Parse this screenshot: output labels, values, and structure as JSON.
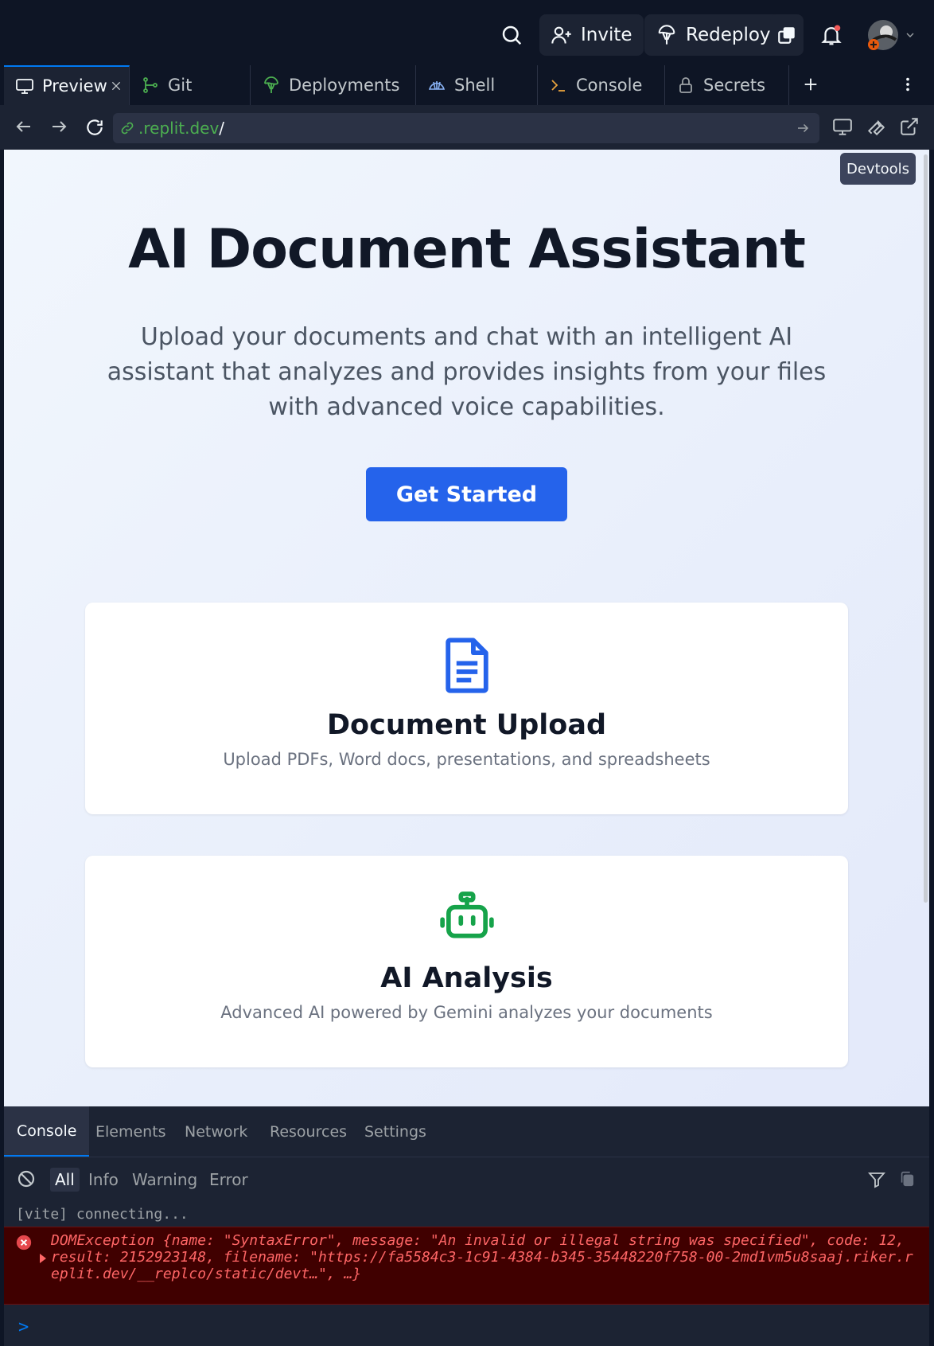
{
  "topbar": {
    "invite_label": "Invite",
    "redeploy_label": "Redeploy",
    "accent_color": "#0079f2",
    "notification_dot_color": "#f25a5a"
  },
  "tabs": [
    {
      "label": "Preview",
      "icon": "monitor-icon",
      "active": true
    },
    {
      "label": "Git",
      "icon": "git-branch-icon"
    },
    {
      "label": "Deployments",
      "icon": "deploy-icon"
    },
    {
      "label": "Shell",
      "icon": "shell-icon"
    },
    {
      "label": "Console",
      "icon": "terminal-icon"
    },
    {
      "label": "Secrets",
      "icon": "lock-icon"
    }
  ],
  "urlbar": {
    "url_domain": ".replit.dev",
    "url_path": "/"
  },
  "tooltip": {
    "label": "Devtools"
  },
  "page": {
    "title": "AI Document Assistant",
    "subtitle": "Upload your documents and chat with an intelligent AI assistant that analyzes and provides insights from your files with advanced voice capabilities.",
    "cta_label": "Get Started",
    "cards": [
      {
        "title": "Document Upload",
        "description": "Upload PDFs, Word docs, presentations, and spreadsheets",
        "icon": "document-icon",
        "icon_color": "#2563eb"
      },
      {
        "title": "AI Analysis",
        "description": "Advanced AI powered by Gemini analyzes your documents",
        "icon": "robot-icon",
        "icon_color": "#16a34a"
      }
    ]
  },
  "devtools": {
    "tabs": [
      "Console",
      "Elements",
      "Network",
      "Resources",
      "Settings"
    ],
    "filters": [
      "All",
      "Info",
      "Warning",
      "Error"
    ],
    "logs": {
      "vite": "[vite] connecting...",
      "error": "DOMException {name: \"SyntaxError\", message: \"An invalid or illegal string was specified\", code: 12, result: 2152923148, filename: \"https://fa5584c3-1c91-4384-b345-35448220f758-00-2md1vm5u8saaj.riker.replit.dev/__replco/static/devt…\", …}"
    },
    "prompt": ">"
  }
}
